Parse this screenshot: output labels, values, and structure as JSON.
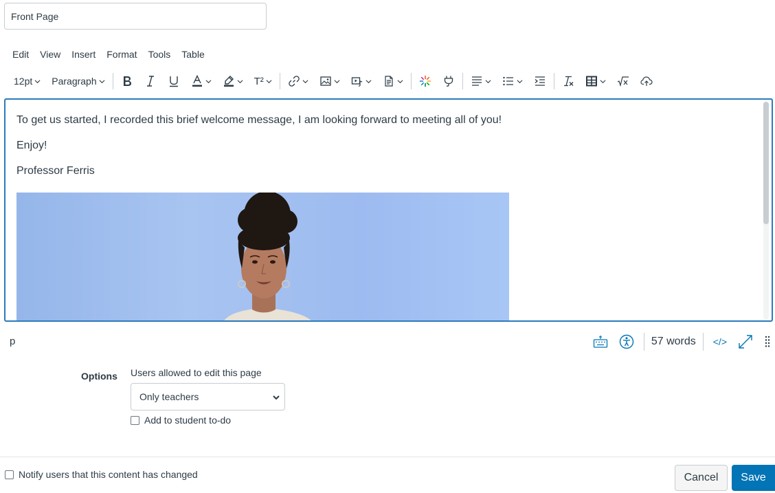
{
  "page_title_value": "Front Page",
  "menubar": [
    "Edit",
    "View",
    "Insert",
    "Format",
    "Tools",
    "Table"
  ],
  "toolbar": {
    "font_size": "12pt",
    "block_format": "Paragraph",
    "superscript_label": "T²"
  },
  "editor": {
    "paragraphs": [
      "To get us started, I recorded this brief welcome message, I am looking forward to meeting all of you!",
      "Enjoy!",
      "Professor Ferris"
    ]
  },
  "statusbar": {
    "path": "p",
    "word_count": "57 words",
    "html_toggle": "</>"
  },
  "options": {
    "section_label": "Options",
    "edit_permission_label": "Users allowed to edit this page",
    "edit_permission_value": "Only teachers",
    "todo_label": "Add to student to-do",
    "todo_checked": false
  },
  "footer": {
    "notify_label": "Notify users that this content has changed",
    "notify_checked": false,
    "cancel_label": "Cancel",
    "save_label": "Save"
  },
  "colors": {
    "accent": "#2b7abc",
    "save_button": "#0374b5",
    "text": "#2d3b45",
    "border": "#c7cdd1"
  },
  "icons": [
    "bold-icon",
    "italic-icon",
    "underline-icon",
    "text-color-icon",
    "highlight-icon",
    "superscript-icon",
    "link-icon",
    "image-icon",
    "media-icon",
    "document-icon",
    "apps-icon",
    "plugin-icon",
    "align-icon",
    "list-icon",
    "indent-icon",
    "clear-formatting-icon",
    "table-icon",
    "equation-icon",
    "cloud-upload-icon",
    "keyboard-icon",
    "accessibility-icon",
    "expand-icon",
    "drag-handle-icon",
    "chevron-down-icon"
  ]
}
